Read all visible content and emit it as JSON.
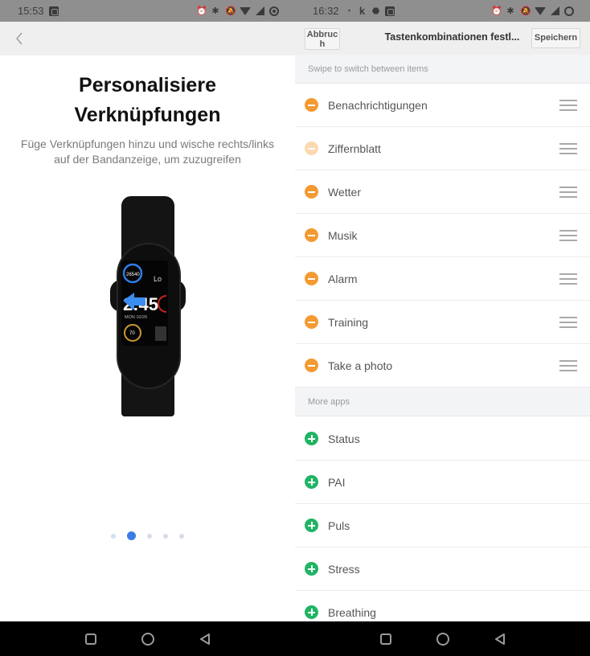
{
  "left": {
    "statusbar": {
      "time": "15:53"
    },
    "header": {
      "back_icon": "chevron-left-icon"
    },
    "title_line1": "Personalisiere",
    "title_line2": "Verknüpfungen",
    "subtitle_line1": "Füge Verknüpfungen hinzu und wische rechts/links",
    "subtitle_line2": "auf der Bandanzeige, um zuzugreifen",
    "band_display": {
      "steps": "26540",
      "time": "2:45",
      "date": "MON 10/26",
      "heart_rate": "70",
      "side_text": "Lo"
    },
    "pager": {
      "total": 5,
      "active_index": 1
    }
  },
  "right": {
    "statusbar": {
      "time": "16:32"
    },
    "header": {
      "cancel_label": "Abbruch",
      "title": "Tastenkombinationen festl...",
      "save_label": "Speichern"
    },
    "active_section_hint": "Swipe to switch between items",
    "active_items": [
      {
        "label": "Benachrichtigungen",
        "disabled": false
      },
      {
        "label": "Ziffernblatt",
        "disabled": true
      },
      {
        "label": "Wetter",
        "disabled": false
      },
      {
        "label": "Musik",
        "disabled": false
      },
      {
        "label": "Alarm",
        "disabled": false
      },
      {
        "label": "Training",
        "disabled": false
      },
      {
        "label": "Take a photo",
        "disabled": false
      }
    ],
    "more_section_label": "More apps",
    "more_items": [
      {
        "label": "Status"
      },
      {
        "label": "PAI"
      },
      {
        "label": "Puls"
      },
      {
        "label": "Stress"
      },
      {
        "label": "Breathing"
      }
    ]
  },
  "colors": {
    "remove": "#f39a32",
    "remove_disabled": "#fbd9b0",
    "add": "#20b464",
    "pager_active": "#3b7ce8"
  }
}
